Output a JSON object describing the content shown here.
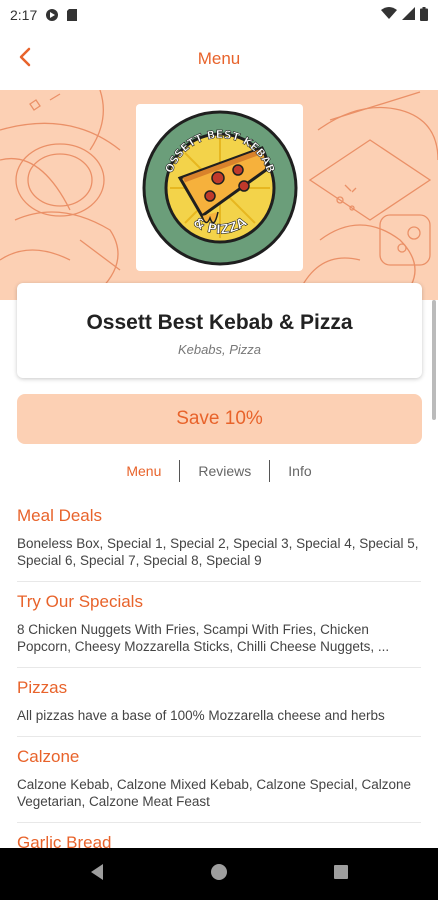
{
  "status_bar": {
    "time": "2:17",
    "left_icons": [
      "app-notification-icon",
      "sd-card-icon"
    ],
    "right_icons": [
      "wifi-icon",
      "signal-icon",
      "battery-icon"
    ]
  },
  "header": {
    "title": "Menu",
    "back_icon": "chevron-left-icon",
    "accent_color": "#e8632b"
  },
  "restaurant": {
    "name": "Ossett Best Kebab & Pizza",
    "cuisine": "Kebabs, Pizza",
    "logo_text_top": "OSSETT BEST KEBAB",
    "logo_text_bottom": "& PIZZA"
  },
  "offer": {
    "label": "Save 10%"
  },
  "tabs": [
    {
      "label": "Menu",
      "active": true
    },
    {
      "label": "Reviews",
      "active": false
    },
    {
      "label": "Info",
      "active": false
    }
  ],
  "categories": [
    {
      "title": "Meal Deals",
      "description": "Boneless Box, Special 1, Special 2, Special 3, Special 4, Special 5, Special 6, Special 7, Special 8, Special 9"
    },
    {
      "title": "Try Our Specials",
      "description": "8 Chicken Nuggets With Fries, Scampi With Fries, Chicken Popcorn, Cheesy Mozzarella Sticks, Chilli Cheese Nuggets, ..."
    },
    {
      "title": "Pizzas",
      "description": "All pizzas have a base of 100% Mozzarella cheese and herbs"
    },
    {
      "title": "Calzone",
      "description": "Calzone Kebab, Calzone Mixed Kebab, Calzone Special, Calzone Vegetarian, Calzone Meat Feast"
    },
    {
      "title": "Garlic Bread",
      "description": ""
    }
  ],
  "colors": {
    "accent": "#e8632b",
    "banner_bg": "#fcd0b4",
    "logo_green": "#6b9e7a",
    "logo_dark": "#1f1f1f"
  }
}
